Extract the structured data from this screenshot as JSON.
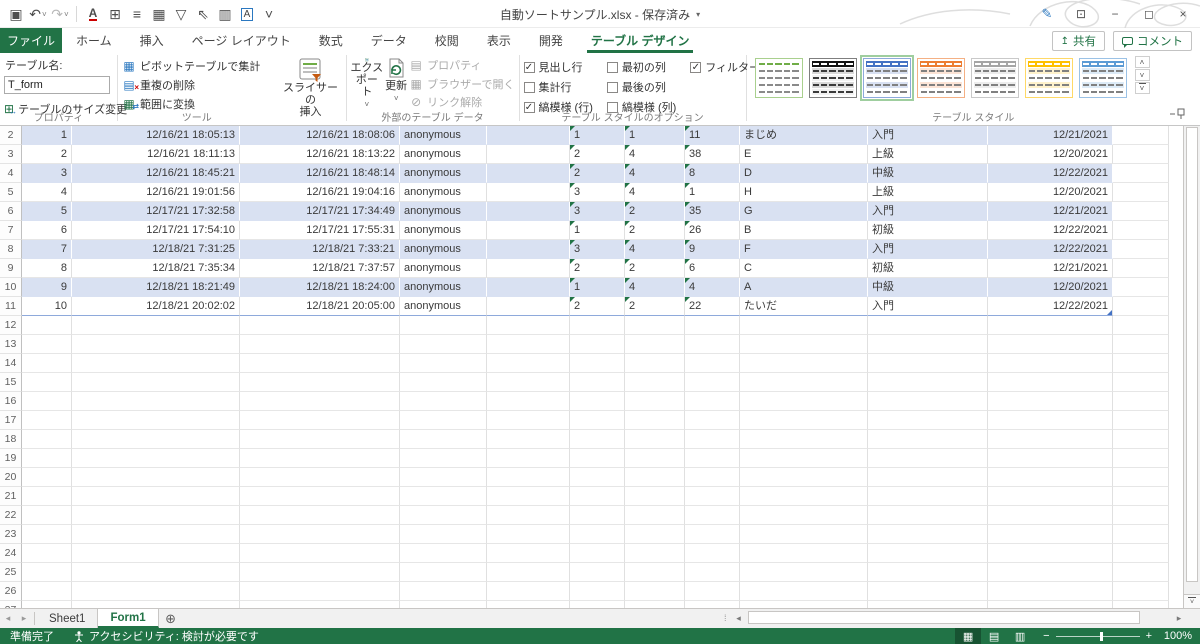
{
  "titlebar": {
    "doc_title": "自動ソートサンプル.xlsx - 保存済み",
    "qat_icons": [
      {
        "name": "save-icon",
        "glyph": "▣"
      },
      {
        "name": "undo-icon",
        "glyph": "↶",
        "chev": true
      },
      {
        "name": "redo-icon",
        "glyph": "↷",
        "chev": true,
        "disabled": true
      },
      {
        "name": "separator"
      },
      {
        "name": "font-underline-icon",
        "glyph": "A",
        "underline": true
      },
      {
        "name": "borders-icon",
        "glyph": "⊞"
      },
      {
        "name": "align-center-icon",
        "glyph": "≡"
      },
      {
        "name": "table-icon",
        "glyph": "▦"
      },
      {
        "name": "filter-icon",
        "glyph": "▽"
      },
      {
        "name": "select-objects-icon",
        "glyph": "⇖"
      },
      {
        "name": "chart-icon",
        "glyph": "▥"
      },
      {
        "name": "textbox-icon",
        "glyph": "A",
        "boxed": true
      },
      {
        "name": "qat-overflow-icon",
        "glyph": "˅"
      }
    ],
    "window_controls": [
      {
        "name": "ink-icon",
        "glyph": "✎",
        "cls": "ink"
      },
      {
        "name": "ribbon-display-options-icon",
        "glyph": "⊡"
      },
      {
        "name": "minimize-icon",
        "glyph": "−"
      },
      {
        "name": "restore-icon",
        "glyph": "◻"
      },
      {
        "name": "close-icon",
        "glyph": "×"
      }
    ]
  },
  "ribbon_tabs": {
    "file": "ファイル",
    "items": [
      {
        "label": "ホーム"
      },
      {
        "label": "挿入"
      },
      {
        "label": "ページ レイアウト"
      },
      {
        "label": "数式"
      },
      {
        "label": "データ"
      },
      {
        "label": "校閲"
      },
      {
        "label": "表示"
      },
      {
        "label": "開発"
      },
      {
        "label": "テーブル デザイン",
        "active": true
      }
    ],
    "share": "共有",
    "comment": "コメント"
  },
  "ribbon": {
    "table_name_label": "テーブル名:",
    "table_name_value": "T_form",
    "resize_table": "テーブルのサイズ変更",
    "group_properties": "プロパティ",
    "tools": [
      "ピボットテーブルで集計",
      "重複の削除",
      "範囲に変換"
    ],
    "slicer_line1": "スライサーの",
    "slicer_line2": "挿入",
    "group_tools": "ツール",
    "export": "エクスポート",
    "refresh": "更新",
    "external_disabled": [
      "プロパティ",
      "ブラウザーで開く",
      "リンク解除"
    ],
    "group_external": "外部のテーブル データ",
    "options_col1": [
      {
        "label": "見出し行",
        "checked": true
      },
      {
        "label": "集計行",
        "checked": false
      },
      {
        "label": "縞模様 (行)",
        "checked": true
      }
    ],
    "options_col2": [
      {
        "label": "最初の列",
        "checked": false
      },
      {
        "label": "最後の列",
        "checked": false
      },
      {
        "label": "縞模様 (列)",
        "checked": false
      }
    ],
    "options_col3": [
      {
        "label": "フィルター ボタン",
        "checked": true
      }
    ],
    "group_options": "テーブル スタイルのオプション",
    "group_styles": "テーブル スタイル"
  },
  "table_styles": [
    {
      "name": "table-style-light-green",
      "header_bg": "#ffffff",
      "header_dash": "#70ad47",
      "band1": "#ffffff",
      "band2": "#ffffff",
      "dash": "#8a8a8a",
      "frame": "#a9d08e",
      "selected": false
    },
    {
      "name": "table-style-dark-black",
      "header_bg": "#111111",
      "header_dash": "#ffffff",
      "band1": "#d9d9d9",
      "band2": "#f2f2f2",
      "dash": "#3a3a3a",
      "frame": "#7f7f7f",
      "selected": false
    },
    {
      "name": "table-style-medium-blue",
      "header_bg": "#4472c4",
      "header_dash": "#ffffff",
      "band1": "#d9e1f2",
      "band2": "#ffffff",
      "dash": "#808080",
      "frame": "#8ea9db",
      "selected": true
    },
    {
      "name": "table-style-medium-orange",
      "header_bg": "#ed7d31",
      "header_dash": "#ffffff",
      "band1": "#fce4d6",
      "band2": "#ffffff",
      "dash": "#808080",
      "frame": "#f4b084",
      "selected": false
    },
    {
      "name": "table-style-medium-gray",
      "header_bg": "#a5a5a5",
      "header_dash": "#ffffff",
      "band1": "#ededed",
      "band2": "#ffffff",
      "dash": "#808080",
      "frame": "#c9c9c9",
      "selected": false
    },
    {
      "name": "table-style-medium-gold",
      "header_bg": "#ffc000",
      "header_dash": "#ffffff",
      "band1": "#fff2cc",
      "band2": "#ffffff",
      "dash": "#808080",
      "frame": "#ffd966",
      "selected": false
    },
    {
      "name": "table-style-medium-blue2",
      "header_bg": "#5b9bd5",
      "header_dash": "#ffffff",
      "band1": "#ddebf7",
      "band2": "#ffffff",
      "dash": "#808080",
      "frame": "#9bc2e6",
      "selected": false
    }
  ],
  "sheet": {
    "first_visible_row": 2,
    "last_visible_row": 27,
    "band_color": "#d9e1f2",
    "error_indicator_color": "#217346",
    "rows": [
      {
        "n": 2,
        "cells": [
          "1",
          "12/16/21 18:05:13",
          "12/16/21 18:08:06",
          "anonymous",
          "",
          "1",
          "1",
          "11",
          "まじめ",
          "入門",
          "12/21/2021"
        ]
      },
      {
        "n": 3,
        "cells": [
          "2",
          "12/16/21 18:11:13",
          "12/16/21 18:13:22",
          "anonymous",
          "",
          "2",
          "4",
          "38",
          "E",
          "上級",
          "12/20/2021"
        ]
      },
      {
        "n": 4,
        "cells": [
          "3",
          "12/16/21 18:45:21",
          "12/16/21 18:48:14",
          "anonymous",
          "",
          "2",
          "4",
          "8",
          "D",
          "中級",
          "12/22/2021"
        ]
      },
      {
        "n": 5,
        "cells": [
          "4",
          "12/16/21 19:01:56",
          "12/16/21 19:04:16",
          "anonymous",
          "",
          "3",
          "4",
          "1",
          "H",
          "上級",
          "12/20/2021"
        ]
      },
      {
        "n": 6,
        "cells": [
          "5",
          "12/17/21 17:32:58",
          "12/17/21 17:34:49",
          "anonymous",
          "",
          "3",
          "2",
          "35",
          "G",
          "入門",
          "12/21/2021"
        ]
      },
      {
        "n": 7,
        "cells": [
          "6",
          "12/17/21 17:54:10",
          "12/17/21 17:55:31",
          "anonymous",
          "",
          "1",
          "2",
          "26",
          "B",
          "初級",
          "12/22/2021"
        ]
      },
      {
        "n": 8,
        "cells": [
          "7",
          "12/18/21 7:31:25",
          "12/18/21 7:33:21",
          "anonymous",
          "",
          "3",
          "4",
          "9",
          "F",
          "入門",
          "12/22/2021"
        ]
      },
      {
        "n": 9,
        "cells": [
          "8",
          "12/18/21 7:35:34",
          "12/18/21 7:37:57",
          "anonymous",
          "",
          "2",
          "2",
          "6",
          "C",
          "初級",
          "12/21/2021"
        ]
      },
      {
        "n": 10,
        "cells": [
          "9",
          "12/18/21 18:21:49",
          "12/18/21 18:24:00",
          "anonymous",
          "",
          "1",
          "4",
          "4",
          "A",
          "中級",
          "12/20/2021"
        ]
      },
      {
        "n": 11,
        "cells": [
          "10",
          "12/18/21 20:02:02",
          "12/18/21 20:05:00",
          "anonymous",
          "",
          "2",
          "2",
          "22",
          "たいだ",
          "入門",
          "12/22/2021"
        ]
      }
    ]
  },
  "sheet_tabs": {
    "items": [
      {
        "label": "Sheet1",
        "active": false
      },
      {
        "label": "Form1",
        "active": true
      }
    ]
  },
  "statusbar": {
    "ready": "準備完了",
    "accessibility": "アクセシビリティ: 検討が必要です",
    "zoom_value": "100%"
  }
}
